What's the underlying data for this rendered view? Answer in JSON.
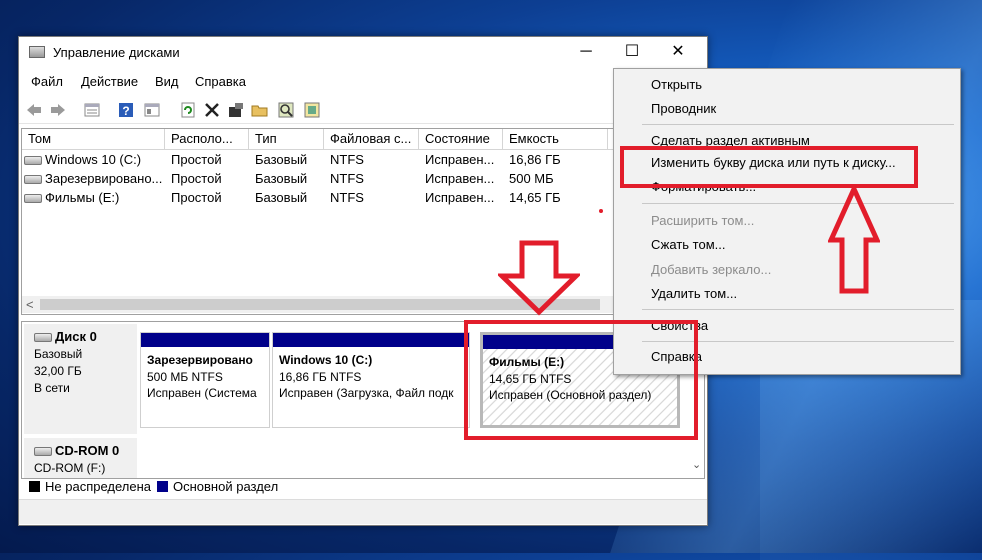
{
  "window": {
    "title": "Управление дисками",
    "minimize": "─",
    "maximize": "☐",
    "close": "✕"
  },
  "menu": [
    "Файл",
    "Действие",
    "Вид",
    "Справка"
  ],
  "toolbar_icons": [
    "back-arrow-icon",
    "forward-arrow-icon",
    "volume-list-icon",
    "help-icon",
    "properties-icon",
    "refresh-icon",
    "delete-icon",
    "disk-settings-icon",
    "open-folder-icon",
    "search-icon",
    "export-icon"
  ],
  "table": {
    "columns": [
      "Том",
      "Располо...",
      "Тип",
      "Файловая с...",
      "Состояние",
      "Емкость"
    ],
    "rows": [
      [
        "Windows 10 (C:)",
        "Простой",
        "Базовый",
        "NTFS",
        "Исправен...",
        "16,86 ГБ"
      ],
      [
        "Зарезервировано...",
        "Простой",
        "Базовый",
        "NTFS",
        "Исправен...",
        "500 МБ"
      ],
      [
        "Фильмы (E:)",
        "Простой",
        "Базовый",
        "NTFS",
        "Исправен...",
        "14,65 ГБ"
      ]
    ],
    "scroll_left": "<"
  },
  "disks": [
    {
      "name": "Диск 0",
      "type": "Базовый",
      "size": "32,00 ГБ",
      "status": "В сети"
    },
    {
      "name": "CD-ROM 0",
      "type": "CD-ROM (F:)",
      "size": "",
      "status": ""
    }
  ],
  "partitions": [
    {
      "title": "Зарезервировано",
      "size": "500 МБ NTFS",
      "status": "Исправен (Система"
    },
    {
      "title": "Windows 10  (C:)",
      "size": "16,86 ГБ NTFS",
      "status": "Исправен (Загрузка, Файл подк"
    },
    {
      "title": "Фильмы  (E:)",
      "size": "14,65 ГБ NTFS",
      "status": "Исправен (Основной раздел)"
    }
  ],
  "legend": [
    {
      "label": "Не распределена",
      "color": "#000000"
    },
    {
      "label": "Основной раздел",
      "color": "#00008a"
    }
  ],
  "scroll_down": "⌄",
  "context_menu": {
    "open": "Открыть",
    "explorer": "Проводник",
    "make_active": "Сделать раздел активным",
    "change_letter": "Изменить букву диска или путь к диску...",
    "format": "Форматировать...",
    "extend": "Расширить том...",
    "shrink": "Сжать том...",
    "add_mirror": "Добавить зеркало...",
    "delete": "Удалить том...",
    "properties": "Свойства",
    "help": "Справка"
  },
  "colors": {
    "annotation_red": "#e21d2b",
    "primary_partition": "#00008a"
  }
}
